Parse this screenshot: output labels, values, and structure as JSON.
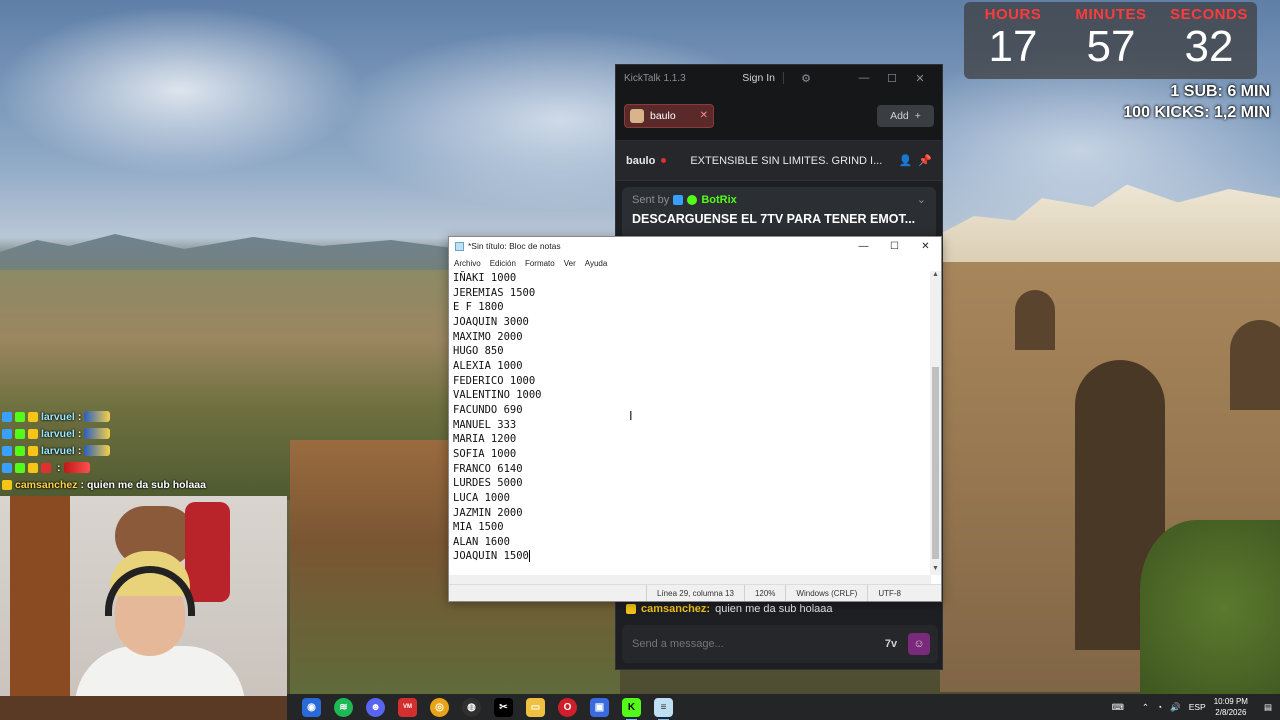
{
  "stream_overlay": {
    "timer": {
      "hours_label": "HOURS",
      "hours": "17",
      "minutes_label": "MINUTES",
      "minutes": "57",
      "seconds_label": "SECONDS",
      "seconds": "32"
    },
    "goals": [
      "1 SUB: 6 MIN",
      "100 KICKS: 1,2 MIN"
    ],
    "chat": [
      {
        "user": "larvuel",
        "suffix": ":"
      },
      {
        "user": "larvuel",
        "suffix": ":"
      },
      {
        "user": "larvuel",
        "suffix": ":"
      },
      {
        "user": "",
        "suffix": ":"
      },
      {
        "user": "camsanchez",
        "message": "quien me da sub holaaa"
      }
    ]
  },
  "kicktalk": {
    "app_title": "KickTalk 1.1.3",
    "sign_in": "Sign In",
    "tab_name": "baulo",
    "add_label": "Add",
    "streamer_name": "baulo",
    "stream_title": "EXTENSIBLE SIN LIMITES. GRIND I...",
    "pinned": {
      "sent_by": "Sent by",
      "bot_name": "BotRix",
      "message": "DESCARGUENSE EL 7TV PARA TENER EMOT..."
    },
    "last_message": {
      "user": "camsanchez:",
      "text": "quien me da sub holaaa"
    },
    "composer_placeholder": "Send a message..."
  },
  "notepad": {
    "title": "*Sin título: Bloc de notas",
    "menu": [
      "Archivo",
      "Edición",
      "Formato",
      "Ver",
      "Ayuda"
    ],
    "lines": [
      "IÑAKI 1000",
      "JEREMIAS 1500",
      "E F 1800",
      "JOAQUIN 3000",
      "MAXIMO 2000",
      "HUGO 850",
      "ALEXIA 1000",
      "FEDERICO 1000",
      "VALENTINO 1000",
      "FACUNDO 690",
      "MANUEL 333",
      "MARIA 1200",
      "SOFIA 1000",
      "FRANCO 6140",
      "LURDES 5000",
      "LUCA 1000",
      "JAZMIN 2000",
      "MIA 1500",
      "ALAN 1600",
      "JOAQUIN 1500"
    ],
    "status": {
      "position": "Línea 29, columna 13",
      "zoom": "120%",
      "line_endings": "Windows (CRLF)",
      "encoding": "UTF-8"
    }
  },
  "taskbar": {
    "apps": [
      "chrome-icon",
      "spotify-icon",
      "discord-icon",
      "voicemod-icon",
      "chrome-icon",
      "obs-icon",
      "capcut-icon",
      "file-explorer-icon",
      "opera-gx-icon",
      "photos-icon",
      "kick-icon",
      "notepad-icon"
    ],
    "language": "ESP",
    "time": "10:09 PM",
    "date": "2/8/2026"
  }
}
